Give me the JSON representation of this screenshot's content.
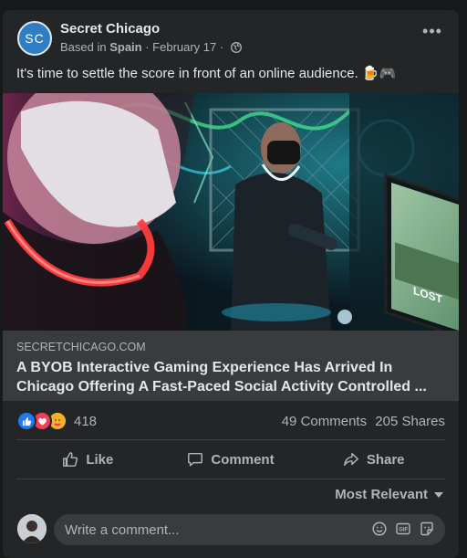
{
  "post": {
    "author": "Secret Chicago",
    "avatar_initials": "SC",
    "based_prefix": "Based in ",
    "location": "Spain",
    "date": " · February 17 · ",
    "text": "It's time to settle the score in front of an online audience. 🍺🎮"
  },
  "link": {
    "domain": "SECRETCHICAGO.COM",
    "title": "A BYOB Interactive Gaming Experience Has Arrived In Chicago Offering A Fast-Paced Social Activity Controlled ..."
  },
  "stats": {
    "reaction_count": "418",
    "comments": "49 Comments",
    "shares": "205 Shares",
    "reaction_icons": [
      "like-icon",
      "love-icon",
      "care-icon"
    ]
  },
  "actions": {
    "like": "Like",
    "comment": "Comment",
    "share": "Share"
  },
  "comments": {
    "sort_label": "Most Relevant",
    "placeholder": "Write a comment..."
  },
  "colors": {
    "background": "#18191a",
    "card": "#242526",
    "primary_text": "#e4e6eb",
    "secondary_text": "#b0b3b8",
    "like_blue": "#2078f4",
    "love_red": "#f33e58"
  }
}
